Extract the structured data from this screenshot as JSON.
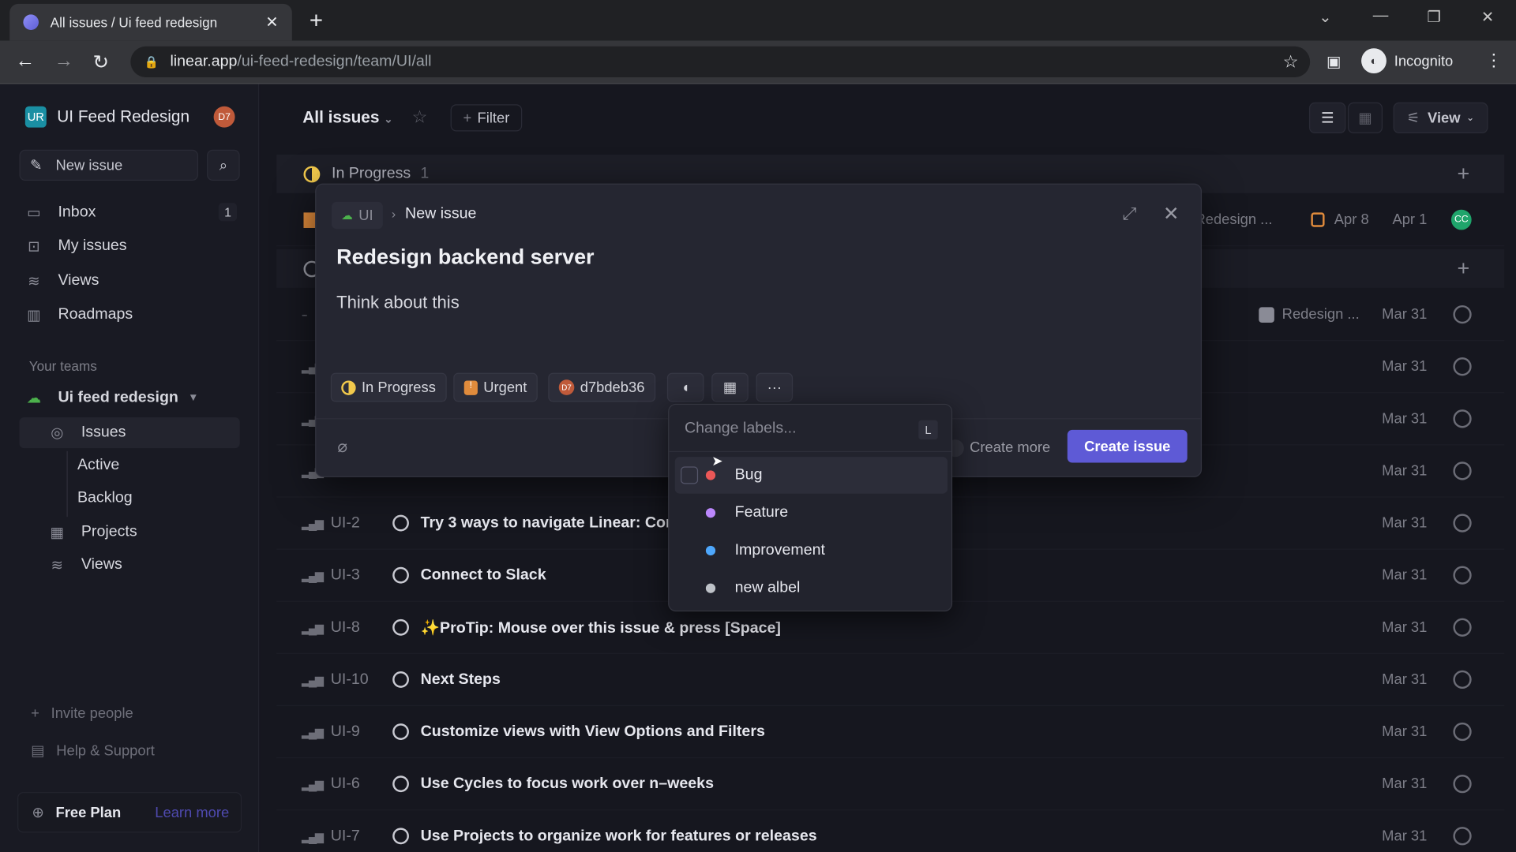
{
  "browser": {
    "tab_title": "All issues / Ui feed redesign",
    "url_domain": "linear.app",
    "url_path": "/ui-feed-redesign/team/UI/all",
    "profile": "Incognito"
  },
  "sidebar": {
    "workspace_initials": "UR",
    "workspace_name": "UI Feed Redesign",
    "user_initials": "D7",
    "new_issue": "New issue",
    "items": [
      {
        "label": "Inbox",
        "badge": "1",
        "icon": "inbox-icon"
      },
      {
        "label": "My issues",
        "icon": "focus-icon"
      },
      {
        "label": "Views",
        "icon": "layers-icon"
      },
      {
        "label": "Roadmaps",
        "icon": "map-icon"
      }
    ],
    "teams_label": "Your teams",
    "team_name": "Ui feed redesign",
    "team_items": [
      {
        "label": "Issues"
      },
      {
        "label": "Active"
      },
      {
        "label": "Backlog"
      },
      {
        "label": "Projects"
      },
      {
        "label": "Views"
      }
    ],
    "invite": "Invite people",
    "help": "Help & Support",
    "plan": "Free Plan",
    "learn_more": "Learn more"
  },
  "header": {
    "title": "All issues",
    "filter": "Filter",
    "view": "View"
  },
  "groups": [
    {
      "name": "In Progress",
      "count": "1",
      "color": "#f2c94c"
    }
  ],
  "in_progress_row": {
    "project": "Redesign ...",
    "due": "Apr 8",
    "date": "Apr 1",
    "assignee": "CC"
  },
  "backlog_first_row": {
    "project": "Redesign ...",
    "date": "Mar 31"
  },
  "hidden_rows_dates": [
    "Mar 31",
    "Mar 31",
    "Mar 31"
  ],
  "rows": [
    {
      "id": "UI-2",
      "title": "Try 3 ways to navigate Linear: Com",
      "date": "Mar 31"
    },
    {
      "id": "UI-3",
      "title": "Connect to Slack",
      "date": "Mar 31"
    },
    {
      "id": "UI-8",
      "title": "✨ProTip: Mouse over this issue & press [Space]",
      "date": "Mar 31"
    },
    {
      "id": "UI-10",
      "title": "Next Steps",
      "date": "Mar 31"
    },
    {
      "id": "UI-9",
      "title": "Customize views with View Options and Filters",
      "date": "Mar 31"
    },
    {
      "id": "UI-6",
      "title": "Use Cycles to focus work over n–weeks",
      "date": "Mar 31"
    },
    {
      "id": "UI-7",
      "title": "Use Projects to organize work for features or releases",
      "date": "Mar 31"
    }
  ],
  "modal": {
    "team": "UI",
    "breadcrumb": "New issue",
    "title": "Redesign backend server",
    "description": "Think about this",
    "status": "In Progress",
    "priority": "Urgent",
    "assignee_initials": "D7",
    "assignee": "d7bdeb36",
    "create_more": "Create more",
    "create": "Create issue",
    "accent": "#5e5ad6"
  },
  "labels_menu": {
    "placeholder": "Change labels...",
    "shortcut": "L",
    "options": [
      {
        "label": "Bug",
        "color": "#eb5757"
      },
      {
        "label": "Feature",
        "color": "#bb87fc"
      },
      {
        "label": "Improvement",
        "color": "#4ea7fc"
      },
      {
        "label": "new albel",
        "color": "#bec2c8"
      }
    ]
  }
}
